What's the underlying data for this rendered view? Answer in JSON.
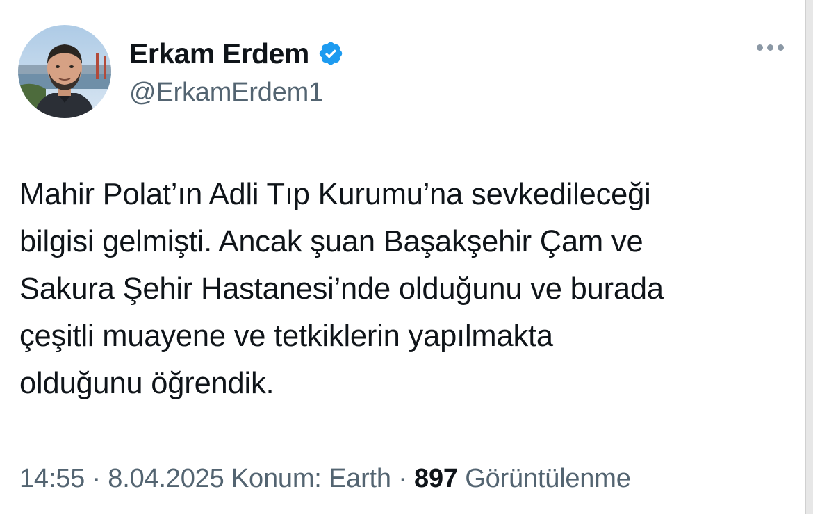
{
  "author": {
    "display_name": "Erkam Erdem",
    "handle": "@ErkamErdem1",
    "verified": true,
    "verified_color": "#1d9bf0"
  },
  "icons": {
    "verified": "verified-badge-icon",
    "more": "more-options-icon"
  },
  "tweet": {
    "text": "Mahir Polat’ın Adli Tıp Kurumu’na sevkedileceği\nbilgisi gelmişti. Ancak şuan Başakşehir Çam ve\nSakura Şehir Hastanesi’nde olduğunu ve burada\nçeşitli muayene ve tetkiklerin yapılmakta\nolduğunu öğrendik."
  },
  "meta": {
    "time": "14:55",
    "separator": "·",
    "date": "8.04.2025",
    "location": "Konum: Earth",
    "views_count": "897",
    "views_label": "Görüntülenme"
  },
  "colors": {
    "text_primary": "#0f1419",
    "text_secondary": "#536471"
  }
}
